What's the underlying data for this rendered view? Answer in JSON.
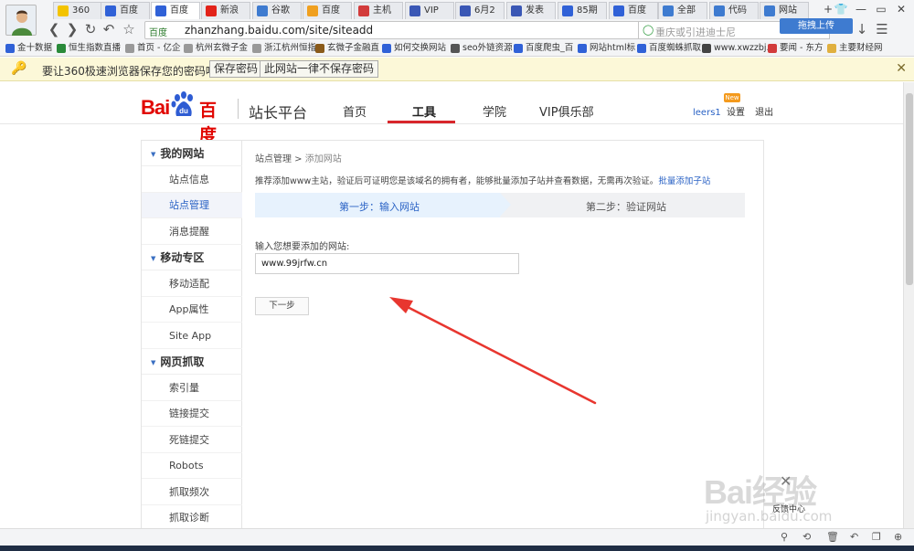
{
  "browser": {
    "tabs": [
      {
        "label": "360",
        "color": "#f3c300"
      },
      {
        "label": "百度",
        "color": "#3061d7"
      },
      {
        "label": "百度",
        "color": "#3061d7",
        "active": true
      },
      {
        "label": "新浪",
        "color": "#e2231a"
      },
      {
        "label": "谷歌",
        "color": "#3e7bd0"
      },
      {
        "label": "百度",
        "color": "#f0a020"
      },
      {
        "label": "主机",
        "color": "#d23b3b"
      },
      {
        "label": "VIP",
        "color": "#3a57b5"
      },
      {
        "label": "6月2",
        "color": "#3a57b5"
      },
      {
        "label": "发表",
        "color": "#3a57b5"
      },
      {
        "label": "85期",
        "color": "#3061d7"
      },
      {
        "label": "百度",
        "color": "#3061d7"
      },
      {
        "label": "全部",
        "color": "#3e7bd0"
      },
      {
        "label": "代码",
        "color": "#3e7bd0"
      },
      {
        "label": "网站",
        "color": "#3e7bd0"
      }
    ],
    "new_tab": "+",
    "url_badge": "百度",
    "url": "zhanzhang.baidu.com/site/siteadd",
    "search_placeholder": "重庆或引进迪士尼",
    "upload_label": "拖拽上传",
    "bookmarks": [
      {
        "label": "金十数据",
        "color": "#3061d7"
      },
      {
        "label": "恒生指数直播",
        "color": "#2a8a3a"
      },
      {
        "label": "首页 - 亿企",
        "color": "#999999"
      },
      {
        "label": "杭州玄微子金",
        "color": "#999999"
      },
      {
        "label": "浙江杭州恒指",
        "color": "#999999"
      },
      {
        "label": "玄微子金融直",
        "color": "#8a5a1a"
      },
      {
        "label": "如何交换网站",
        "color": "#3061d7"
      },
      {
        "label": "seo外链资源",
        "color": "#555555"
      },
      {
        "label": "百度爬虫_百",
        "color": "#3061d7"
      },
      {
        "label": "网站html标",
        "color": "#3061d7"
      },
      {
        "label": "百度蜘蛛抓取",
        "color": "#3061d7"
      },
      {
        "label": "www.xwzzbj.",
        "color": "#444444"
      },
      {
        "label": "要闻 - 东方",
        "color": "#d23b3b"
      },
      {
        "label": "主要财经网",
        "color": "#e0b040"
      }
    ]
  },
  "password_bar": {
    "message": "要让360极速浏览器保存您的密码吗？",
    "save_label": "保存密码",
    "never_label": "此网站一律不保存密码",
    "close": "✕"
  },
  "header": {
    "logo_bai": "Bai",
    "logo_du": "百度",
    "site_name": "站长平台",
    "nav": [
      {
        "label": "首页"
      },
      {
        "label": "工具",
        "active": true
      },
      {
        "label": "学院"
      },
      {
        "label": "VIP俱乐部"
      }
    ],
    "username": "leers1",
    "new_badge": "New",
    "settings_label": "设置",
    "logout_label": "退出"
  },
  "sidebar": {
    "sections": [
      {
        "title": "我的网站",
        "items": [
          "站点信息",
          "站点管理",
          "消息提醒"
        ],
        "active_index": 1
      },
      {
        "title": "移动专区",
        "items": [
          "移动适配",
          "App属性",
          "Site App"
        ]
      },
      {
        "title": "网页抓取",
        "items": [
          "索引量",
          "链接提交",
          "死链提交",
          "Robots",
          "抓取频次",
          "抓取诊断"
        ]
      }
    ]
  },
  "main": {
    "breadcrumb_parent": "站点管理",
    "breadcrumb_sep": " > ",
    "breadcrumb_current": "添加网站",
    "info_text": "推荐添加www主站，验证后可证明您是该域名的拥有者，能够批量添加子站并查看数据，无需再次验证。",
    "info_link": "批量添加子站",
    "step1_label": "第一步：输入网站",
    "step2_label": "第二步：验证网站",
    "field_label": "输入您想要添加的网站:",
    "site_value": "www.99jrfw.cn",
    "next_label": "下一步"
  },
  "feedback": {
    "label": "反馈中心"
  },
  "watermark": {
    "text": "Bai经验",
    "sub": "jingyan.baidu.com"
  },
  "colors": {
    "accent": "#2b63c5",
    "baidu_red": "#e10601",
    "annotation_arrow": "#e8362f"
  }
}
